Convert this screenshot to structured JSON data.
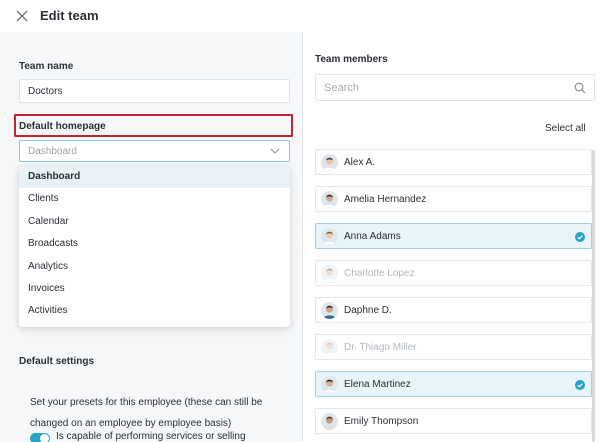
{
  "header": {
    "title": "Edit team",
    "close_icon": "close-icon"
  },
  "team_name": {
    "label": "Team name",
    "value": "Doctors"
  },
  "default_homepage": {
    "label": "Default homepage",
    "placeholder": "Dashboard",
    "options": [
      {
        "label": "Dashboard",
        "selected": true
      },
      {
        "label": "Clients",
        "selected": false
      },
      {
        "label": "Calendar",
        "selected": false
      },
      {
        "label": "Broadcasts",
        "selected": false
      },
      {
        "label": "Analytics",
        "selected": false
      },
      {
        "label": "Invoices",
        "selected": false
      },
      {
        "label": "Activities",
        "selected": false
      }
    ]
  },
  "default_settings": {
    "title": "Default settings",
    "description": "Set your presets for this employee (these can still be changed on an employee by employee basis)",
    "toggle_label": "Is capable of performing services or selling",
    "toggle_on": true
  },
  "team_members": {
    "title": "Team members",
    "search_placeholder": "Search",
    "select_all_label": "Select all",
    "members": [
      {
        "name": "Alex A.",
        "selected": false,
        "disabled": false
      },
      {
        "name": "Amelia Hernandez",
        "selected": false,
        "disabled": false
      },
      {
        "name": "Anna Adams",
        "selected": true,
        "disabled": false
      },
      {
        "name": "Charlotte Lopez",
        "selected": false,
        "disabled": true
      },
      {
        "name": "Daphne D.",
        "selected": false,
        "disabled": false
      },
      {
        "name": "Dr. Thiago Miller",
        "selected": false,
        "disabled": true
      },
      {
        "name": "Elena Martinez",
        "selected": true,
        "disabled": false
      },
      {
        "name": "Emily Thompson",
        "selected": false,
        "disabled": false
      }
    ]
  },
  "colors": {
    "accent": "#27a3c9",
    "highlight": "#c8242f",
    "selected_row": "#e9f4f8"
  }
}
